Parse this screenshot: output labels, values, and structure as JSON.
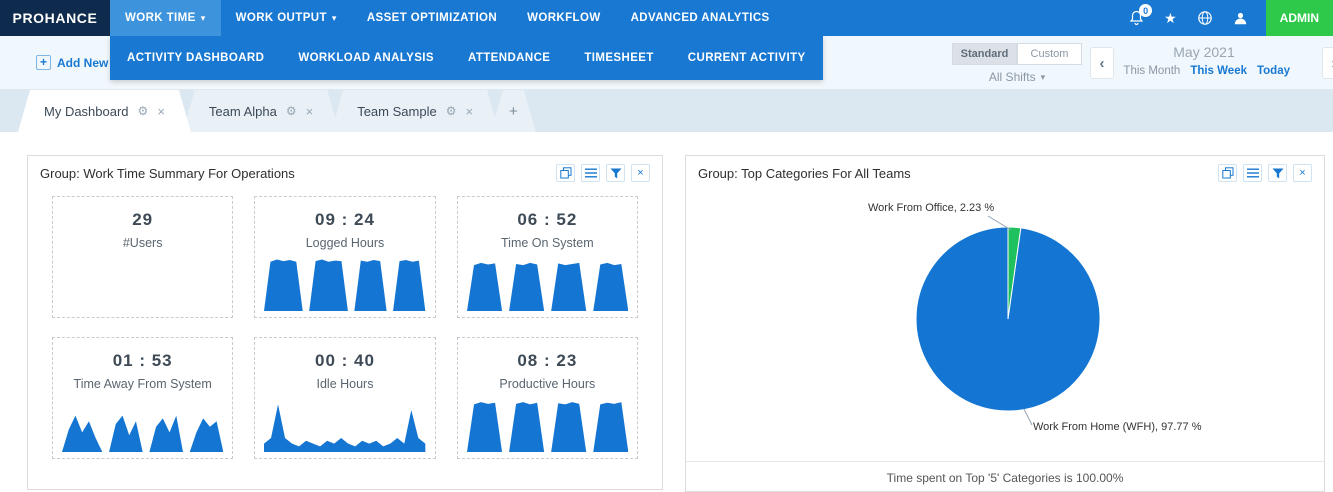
{
  "colors": {
    "navbar": "#1878d2",
    "logo_bg": "#0e2b4d",
    "accent": "#1878d2",
    "admin_green": "#2ec84b",
    "spark": "#1476d2"
  },
  "icons": {
    "caret_down": "▾",
    "chevron_left": "‹",
    "chevron_right": "›",
    "close": "×",
    "gear": "⚙",
    "plus": "+",
    "star": "★"
  },
  "navbar": {
    "logo": "PROHANCE",
    "items": [
      {
        "label": "WORK TIME"
      },
      {
        "label": "WORK OUTPUT"
      },
      {
        "label": "ASSET OPTIMIZATION"
      },
      {
        "label": "WORKFLOW"
      },
      {
        "label": "ADVANCED ANALYTICS"
      }
    ],
    "notification_count": "0",
    "admin_label": "ADMIN"
  },
  "submenu": {
    "items": [
      "ACTIVITY DASHBOARD",
      "WORKLOAD ANALYSIS",
      "ATTENDANCE",
      "TIMESHEET",
      "CURRENT ACTIVITY"
    ]
  },
  "toolbar": {
    "add_new": "Add New W",
    "view_standard": "Standard",
    "view_custom": "Custom",
    "shift_filter": "All Shifts",
    "period": "May 2021",
    "links": {
      "this_month": "This Month",
      "this_week": "This Week",
      "today": "Today"
    }
  },
  "tabs": [
    {
      "label": "My Dashboard"
    },
    {
      "label": "Team Alpha"
    },
    {
      "label": "Team Sample"
    }
  ],
  "left_panel": {
    "title": "Group: Work Time Summary For Operations",
    "tiles": [
      {
        "value": "29",
        "label": "#Users"
      },
      {
        "value": "09 : 24",
        "label": "Logged Hours",
        "spark": [
          0,
          8.8,
          9.2,
          8.9,
          9.1,
          8.8,
          0,
          0,
          8.9,
          9.2,
          8.8,
          9.0,
          8.9,
          0,
          0,
          9.0,
          8.8,
          9.1,
          8.9,
          0,
          0,
          8.9,
          9.1,
          8.8,
          9.0,
          0
        ]
      },
      {
        "value": "06 : 52",
        "label": "Time On System",
        "spark": [
          0,
          8.2,
          8.6,
          8.3,
          8.5,
          0,
          0,
          8.4,
          8.2,
          8.6,
          8.3,
          0,
          0,
          8.5,
          8.2,
          8.4,
          8.6,
          0,
          0,
          8.3,
          8.6,
          8.2,
          8.4,
          0
        ]
      },
      {
        "value": "01 : 53",
        "label": "Time Away From System",
        "spark": [
          0,
          4,
          6.5,
          3.5,
          5.5,
          2.5,
          0,
          0,
          5,
          6.5,
          3,
          5.5,
          0,
          0,
          4.5,
          6,
          3.5,
          6.5,
          0,
          0,
          3.5,
          6,
          4.5,
          5.5,
          0
        ]
      },
      {
        "value": "00 : 40",
        "label": "Idle Hours",
        "spark": [
          1.5,
          2.5,
          8.5,
          2.5,
          1.5,
          1,
          2,
          1.5,
          1,
          2,
          1.5,
          2.5,
          1.5,
          1,
          2,
          1.5,
          2,
          1,
          1.5,
          2.5,
          1.5,
          7.5,
          2.5,
          1.5
        ]
      },
      {
        "value": "08 : 23",
        "label": "Productive Hours",
        "spark": [
          0,
          8.5,
          8.9,
          8.6,
          8.8,
          0,
          0,
          8.6,
          8.9,
          8.5,
          8.8,
          0,
          0,
          8.7,
          8.5,
          8.9,
          8.6,
          0,
          0,
          8.5,
          8.8,
          8.6,
          8.9,
          0
        ]
      }
    ]
  },
  "right_panel": {
    "title": "Group: Top Categories For All Teams",
    "footer": "Time spent on Top '5' Categories is 100.00%",
    "chart_data": {
      "type": "pie",
      "labels": [
        "Work From Office",
        "Work From Home (WFH)"
      ],
      "values": [
        2.23,
        97.77
      ],
      "colors": [
        "#1fc05e",
        "#1476d2"
      ],
      "label_texts": [
        "Work From Office, 2.23 %",
        "Work From Home (WFH), 97.77 %"
      ],
      "legend_position": "callout-labels"
    }
  }
}
